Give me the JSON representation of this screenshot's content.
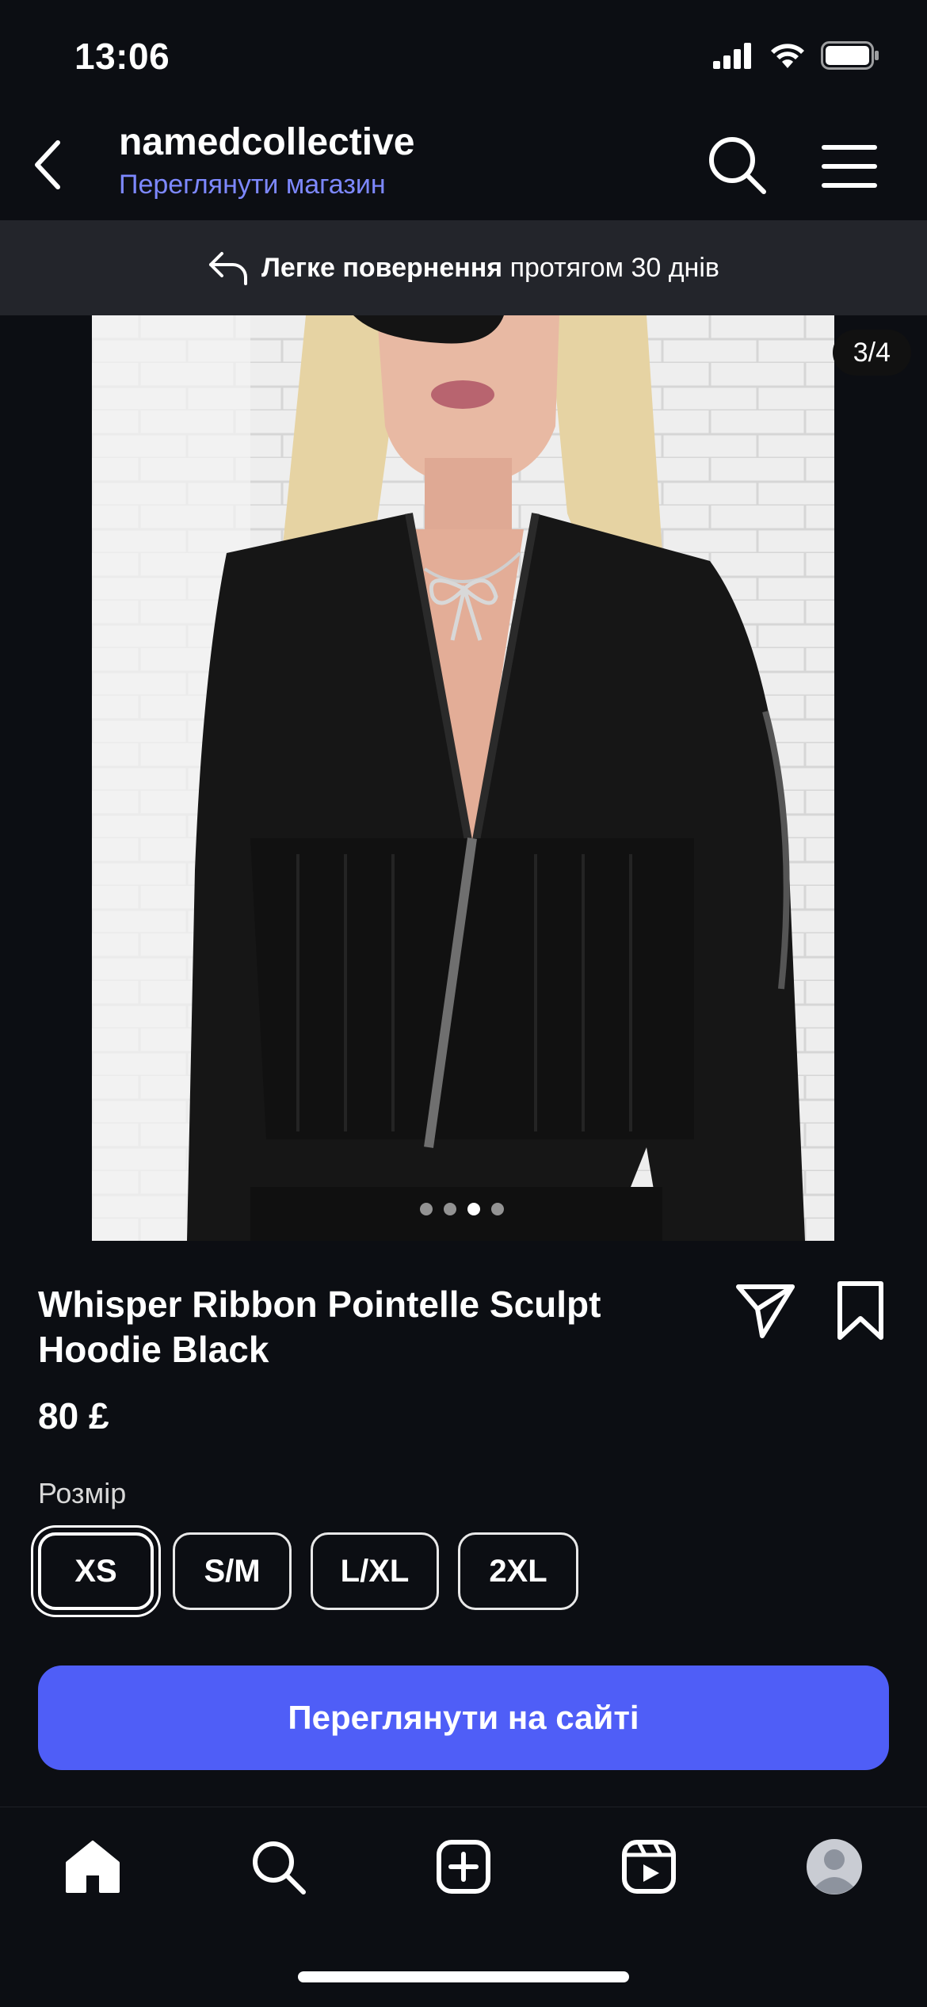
{
  "status_bar": {
    "time": "13:06"
  },
  "header": {
    "shop_name": "namedcollective",
    "shop_link": "Переглянути магазин"
  },
  "returns_banner": {
    "bold_text": "Легке повернення",
    "rest_text": "протягом 30 днів"
  },
  "gallery": {
    "counter": "3/4",
    "dot_count": 4,
    "active_index": 2
  },
  "product": {
    "title": "Whisper Ribbon Pointelle Sculpt Hoodie Black",
    "price": "80 £",
    "size_label": "Розмір",
    "sizes": [
      "XS",
      "S/M",
      "L/XL",
      "2XL"
    ],
    "selected_size": "XS",
    "cta_label": "Переглянути на сайті"
  },
  "colors": {
    "background": "#0c0e13",
    "accent": "#4f5ef7",
    "link": "#7d88ff"
  },
  "icons": {
    "back": "chevron-left-icon",
    "search": "search-icon",
    "menu": "menu-icon",
    "returns": "return-arrow-icon",
    "share": "send-icon",
    "save": "bookmark-icon",
    "nav": [
      "home-icon",
      "search-icon",
      "add-icon",
      "reels-icon",
      "profile-icon"
    ]
  }
}
